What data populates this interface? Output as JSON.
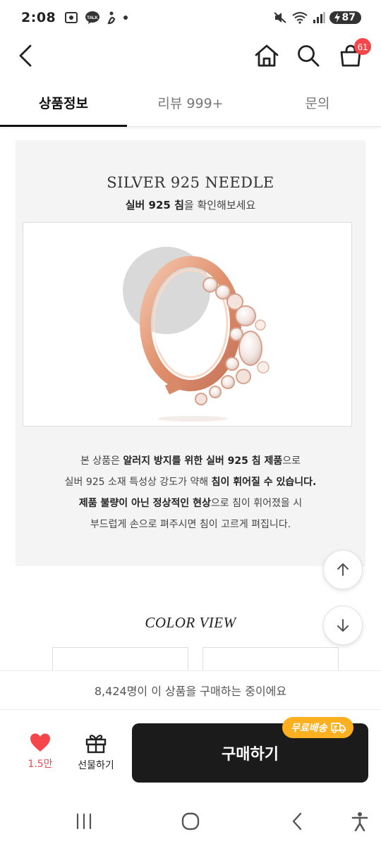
{
  "status_bar": {
    "time": "2:08",
    "battery": "87",
    "left_icons": [
      "screenshot-icon",
      "kakaotalk-icon",
      "app-notification-icon",
      "dot-icon"
    ],
    "right_icons": [
      "mute-icon",
      "wifi-icon",
      "signal-icon",
      "battery-icon"
    ]
  },
  "header": {
    "back_icon": "back-arrow-icon",
    "home_icon": "home-icon",
    "search_icon": "search-icon",
    "cart_icon": "shopping-bag-icon",
    "cart_count": "61"
  },
  "tabs": [
    {
      "label": "상품정보",
      "active": true
    },
    {
      "label": "리뷰 999+",
      "active": false
    },
    {
      "label": "문의",
      "active": false
    }
  ],
  "needle_section": {
    "title": "SILVER 925 NEEDLE",
    "subtitle_bold": "실버 925 침",
    "subtitle_rest": "을 확인해보세요",
    "desc_line1_a": "본 상품은 ",
    "desc_line1_b": "알러지 방지를 위한 실버 925 침 제품",
    "desc_line1_c": "으로",
    "desc_line2_a": "실버 925 소재 특성상 강도가 약해 ",
    "desc_line2_b": "침이 휘어질 수 있습니다.",
    "desc_line3_a": "제품 불량이 아닌 정상적인 현상",
    "desc_line3_b": "으로 침이 휘어졌을 시",
    "desc_line4": "부드럽게 손으로 펴주시면 침이 고르게 펴집니다."
  },
  "color_view": {
    "title": "COLOR VIEW"
  },
  "purchase_notice": "8,424명이 이 상품을 구매하는 중이에요",
  "actions": {
    "like_count": "1.5만",
    "gift_label": "선물하기",
    "buy_label": "구매하기",
    "free_shipping": "무료배송"
  },
  "colors": {
    "accent_red": "#f5474b",
    "buy_button": "#1b1b1b",
    "free_ship_badge": "#ffb020"
  }
}
